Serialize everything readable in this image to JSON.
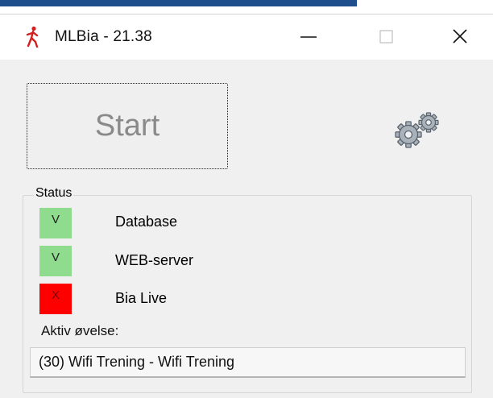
{
  "window": {
    "title": "MLBia - 21.38",
    "icon": "runner-icon",
    "controls": {
      "minimize": "minimize-icon",
      "maximize": "maximize-icon",
      "close": "close-icon"
    }
  },
  "main": {
    "start_button_label": "Start",
    "settings_icon": "gears-icon"
  },
  "status": {
    "legend": "Status",
    "items": [
      {
        "indicator": "V",
        "label": "Database",
        "state": "ok",
        "color": "#8fdc8f"
      },
      {
        "indicator": "V",
        "label": "WEB-server",
        "state": "ok",
        "color": "#8fdc8f"
      },
      {
        "indicator": "X",
        "label": "Bia Live",
        "state": "error",
        "color": "#ff0000"
      }
    ],
    "active_exercise_label": "Aktiv øvelse:",
    "active_exercise_value": "(30) Wifi Trening - Wifi Trening"
  }
}
